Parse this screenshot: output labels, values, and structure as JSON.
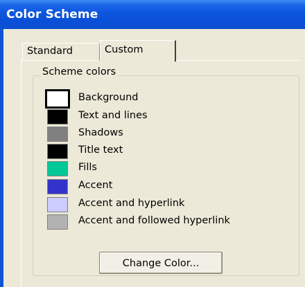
{
  "dialog": {
    "title": "Color Scheme"
  },
  "tabs": [
    {
      "label": "Standard",
      "selected": false
    },
    {
      "label": "Custom",
      "selected": true
    }
  ],
  "scheme_colors": {
    "group_label": "Scheme colors",
    "items": [
      {
        "label": "Background",
        "color": "#ffffff",
        "selected": true
      },
      {
        "label": "Text and lines",
        "color": "#000000",
        "selected": false
      },
      {
        "label": "Shadows",
        "color": "#808080",
        "selected": false
      },
      {
        "label": "Title text",
        "color": "#000000",
        "selected": false
      },
      {
        "label": "Fills",
        "color": "#00c896",
        "selected": false
      },
      {
        "label": "Accent",
        "color": "#3333cc",
        "selected": false
      },
      {
        "label": "Accent and hyperlink",
        "color": "#ccccff",
        "selected": false
      },
      {
        "label": "Accent and followed hyperlink",
        "color": "#b2b2b2",
        "selected": false
      }
    ]
  },
  "buttons": {
    "change_color": "Change Color..."
  }
}
